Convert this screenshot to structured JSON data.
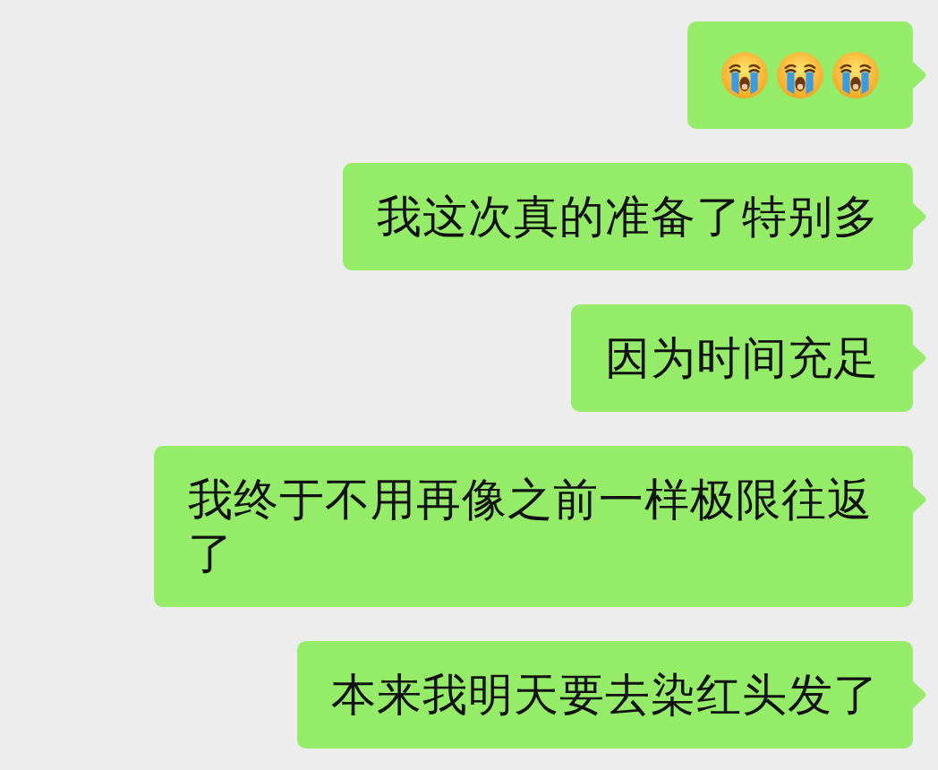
{
  "messages": [
    {
      "kind": "emoji",
      "emojis": [
        {
          "kind": "crying"
        },
        {
          "kind": "crying"
        },
        {
          "kind": "crying"
        }
      ]
    },
    {
      "kind": "text",
      "text": "我这次真的准备了特别多"
    },
    {
      "kind": "text",
      "text": "因为时间充足"
    },
    {
      "kind": "text",
      "text": "我终于不用再像之前一样极限往返了"
    },
    {
      "kind": "text",
      "text": "本来我明天要去染红头发了"
    }
  ]
}
